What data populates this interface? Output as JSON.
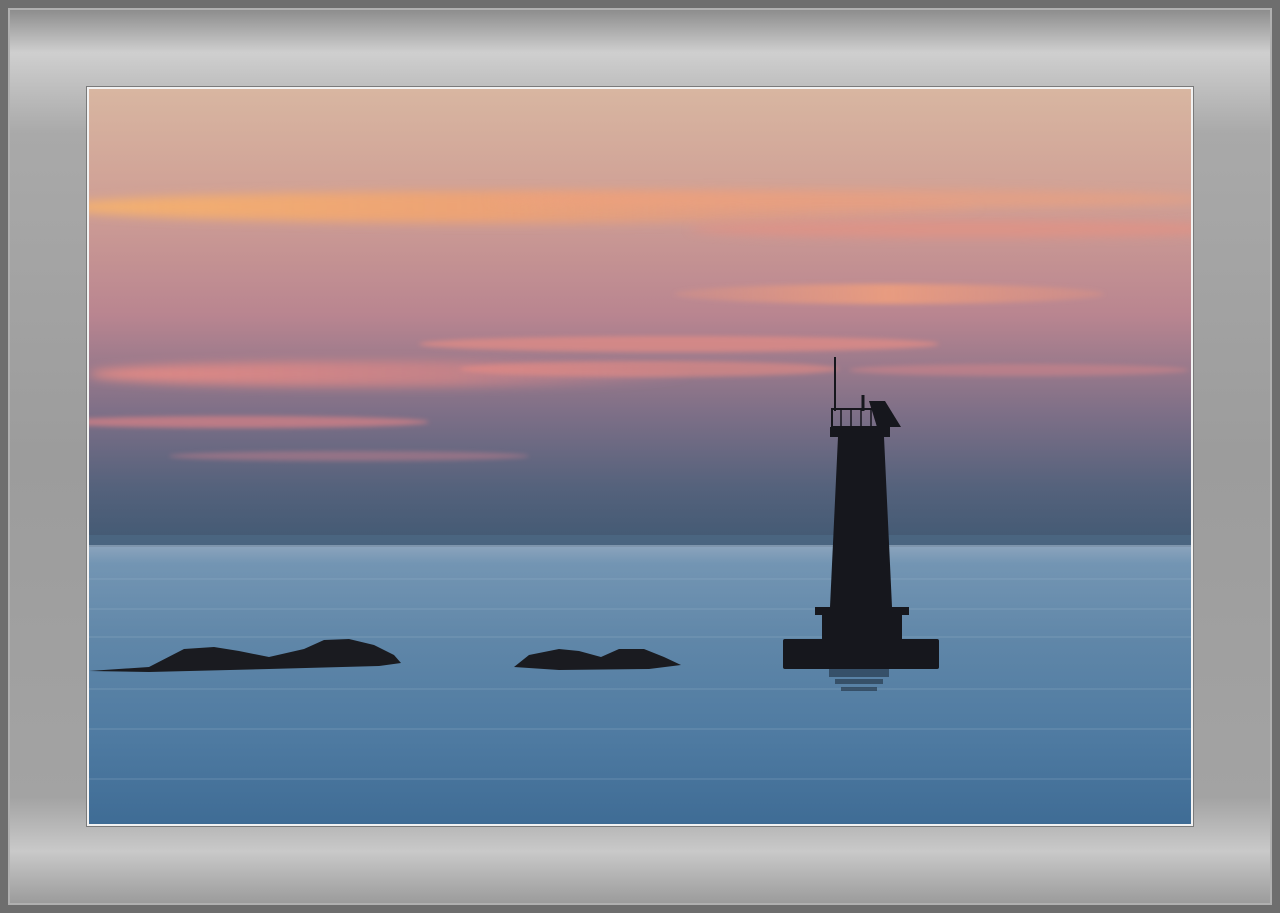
{
  "scene": {
    "subject": "lighthouse",
    "colors": {
      "sky_top": "#d7b3a0",
      "sky_mid": "#c08a8e",
      "sky_low": "#6d6b86",
      "horizon": "#3f5672",
      "sea_top": "#6c8fae",
      "sea_bottom": "#3f6f98",
      "cloud_glow": "#f4a36f",
      "cloud_pink": "#ec8a86",
      "silhouette": "#17181f",
      "mat": "#a0a0a0",
      "frame_line": "#f2f2f2"
    }
  }
}
